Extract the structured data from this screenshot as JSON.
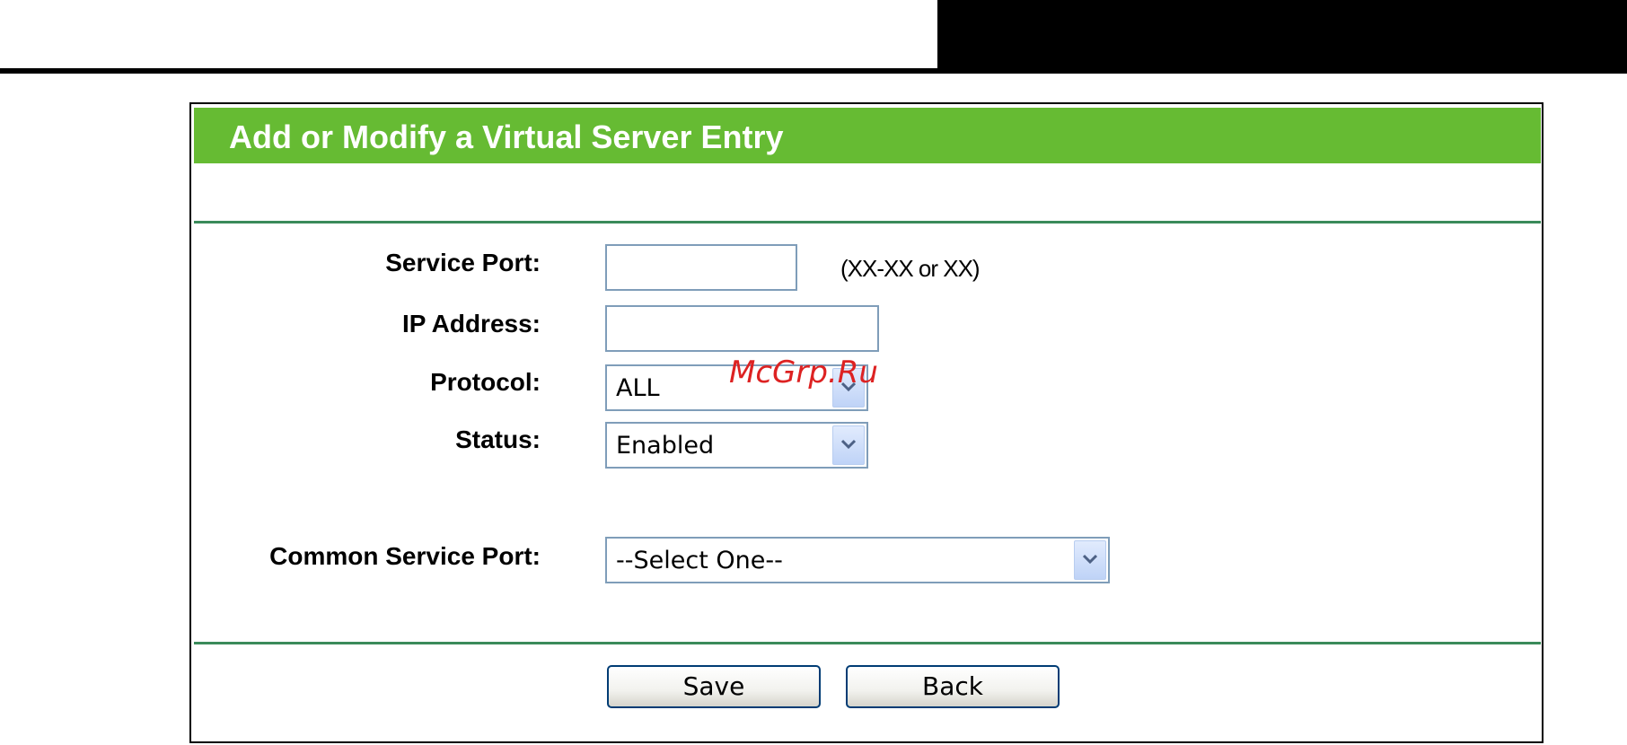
{
  "panel": {
    "title": "Add or Modify a Virtual Server Entry"
  },
  "form": {
    "service_port": {
      "label": "Service Port:",
      "value": "",
      "hint": "(XX-XX or XX)"
    },
    "ip_address": {
      "label": "IP Address:",
      "value": ""
    },
    "protocol": {
      "label": "Protocol:",
      "value": "ALL"
    },
    "status": {
      "label": "Status:",
      "value": "Enabled"
    },
    "common_service_port": {
      "label": "Common Service Port:",
      "value": "--Select One--"
    }
  },
  "buttons": {
    "save": "Save",
    "back": "Back"
  },
  "watermark": "McGrp.Ru",
  "colors": {
    "header_green": "#66bb33",
    "rule_green": "#3a8a5a",
    "watermark_red": "#dd2222"
  },
  "icons": {
    "dropdown": "chevron-down-icon"
  }
}
